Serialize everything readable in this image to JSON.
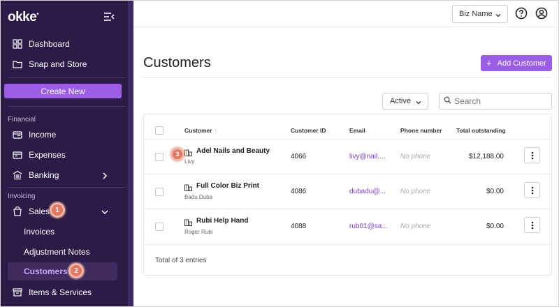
{
  "app": {
    "logo": "okke"
  },
  "sidebar": {
    "top_items": [
      {
        "label": "Dashboard",
        "icon": "grid-icon"
      },
      {
        "label": "Snap and Store",
        "icon": "folder-icon"
      }
    ],
    "create_label": "Create New",
    "financial_label": "Financial",
    "financial_items": [
      {
        "label": "Income",
        "icon": "income-icon"
      },
      {
        "label": "Expenses",
        "icon": "expenses-icon"
      },
      {
        "label": "Banking",
        "icon": "bank-icon"
      }
    ],
    "invoicing_label": "Invoicing",
    "sales_label": "Sales",
    "sales_sub": [
      {
        "label": "Invoices"
      },
      {
        "label": "Adjustment Notes"
      },
      {
        "label": "Customers"
      }
    ],
    "items_label": "Items & Services"
  },
  "steps": {
    "one": "1",
    "two": "2",
    "three": "3"
  },
  "topbar": {
    "biz_name": "Biz Name"
  },
  "page": {
    "title": "Customers",
    "add_label": "Add Customer",
    "status_value": "Active",
    "search_placeholder": "Search"
  },
  "table": {
    "headers": {
      "customer": "Customer",
      "id": "Customer ID",
      "email": "Email",
      "phone": "Phone number",
      "outstanding": "Total outstanding"
    },
    "rows": [
      {
        "name": "Adel Nails and Beauty",
        "contact": "Livy",
        "id": "4066",
        "email": "livy@nail....",
        "phone": "No phone",
        "outstanding": "$12,188.00"
      },
      {
        "name": "Full Color Biz Print",
        "contact": "Badu Duba",
        "id": "4086",
        "email": "dubadu@...",
        "phone": "No phone",
        "outstanding": "$0.00"
      },
      {
        "name": "Rubi Help Hand",
        "contact": "Roger Rubi",
        "id": "4088",
        "email": "rub01@sa...",
        "phone": "No phone",
        "outstanding": "$0.00"
      }
    ],
    "footer": "Total of 3 entries"
  },
  "colors": {
    "sidebar_bg": "#2c1a47",
    "accent": "#9b5de5",
    "link": "#7a3fc0",
    "badge": "#e07a66"
  }
}
